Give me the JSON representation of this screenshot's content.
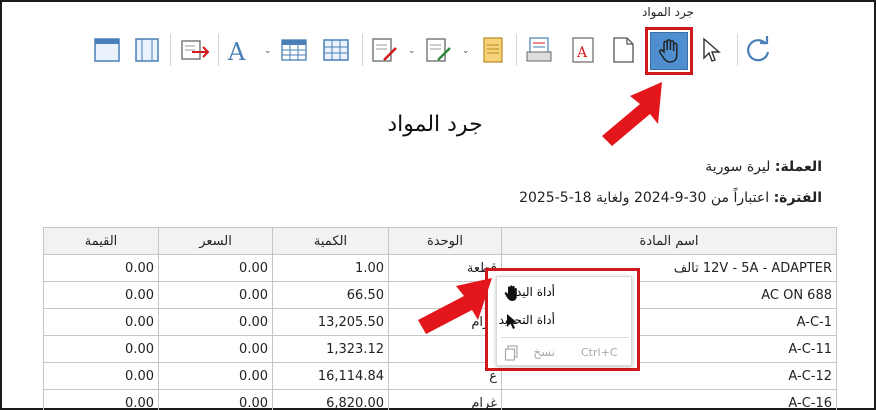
{
  "toolbar": {
    "tooltip": "جرد المواد"
  },
  "report": {
    "title": "جرد المواد",
    "currency_label": "العملة:",
    "currency_value": "ليرة سورية",
    "period_label": "الفترة:",
    "period_value": "اعتباراً من 30-9-2024 ولغاية 18-5-2025"
  },
  "table": {
    "headers": [
      "اسم المادة",
      "الوحدة",
      "الكمية",
      "السعر",
      "القيمة"
    ],
    "rows": [
      {
        "name": "12V - 5A - ADAPTER تالف",
        "unit": "قطعة",
        "qty": "1.00",
        "price": "0.00",
        "value": "0.00"
      },
      {
        "name": "AC ON 688",
        "unit": "ع",
        "qty": "66.50",
        "price": "0.00",
        "value": "0.00"
      },
      {
        "name": "A-C-1",
        "unit": "غرام",
        "qty": "13,205.50",
        "price": "0.00",
        "value": "0.00"
      },
      {
        "name": "A-C-11",
        "unit": "",
        "qty": "1,323.12",
        "price": "0.00",
        "value": "0.00"
      },
      {
        "name": "A-C-12",
        "unit": "ع",
        "qty": "16,114.84",
        "price": "0.00",
        "value": "0.00"
      },
      {
        "name": "A-C-16",
        "unit": "غرام",
        "qty": "6,820.00",
        "price": "0.00",
        "value": "0.00"
      }
    ]
  },
  "context_menu": {
    "hand_tool": "أداة اليد",
    "select_tool": "أداة التحديد",
    "copy": "نسخ",
    "copy_shortcut": "Ctrl+C"
  },
  "colors": {
    "highlight": "#d0191c",
    "active_button": "#4f8fcf"
  }
}
